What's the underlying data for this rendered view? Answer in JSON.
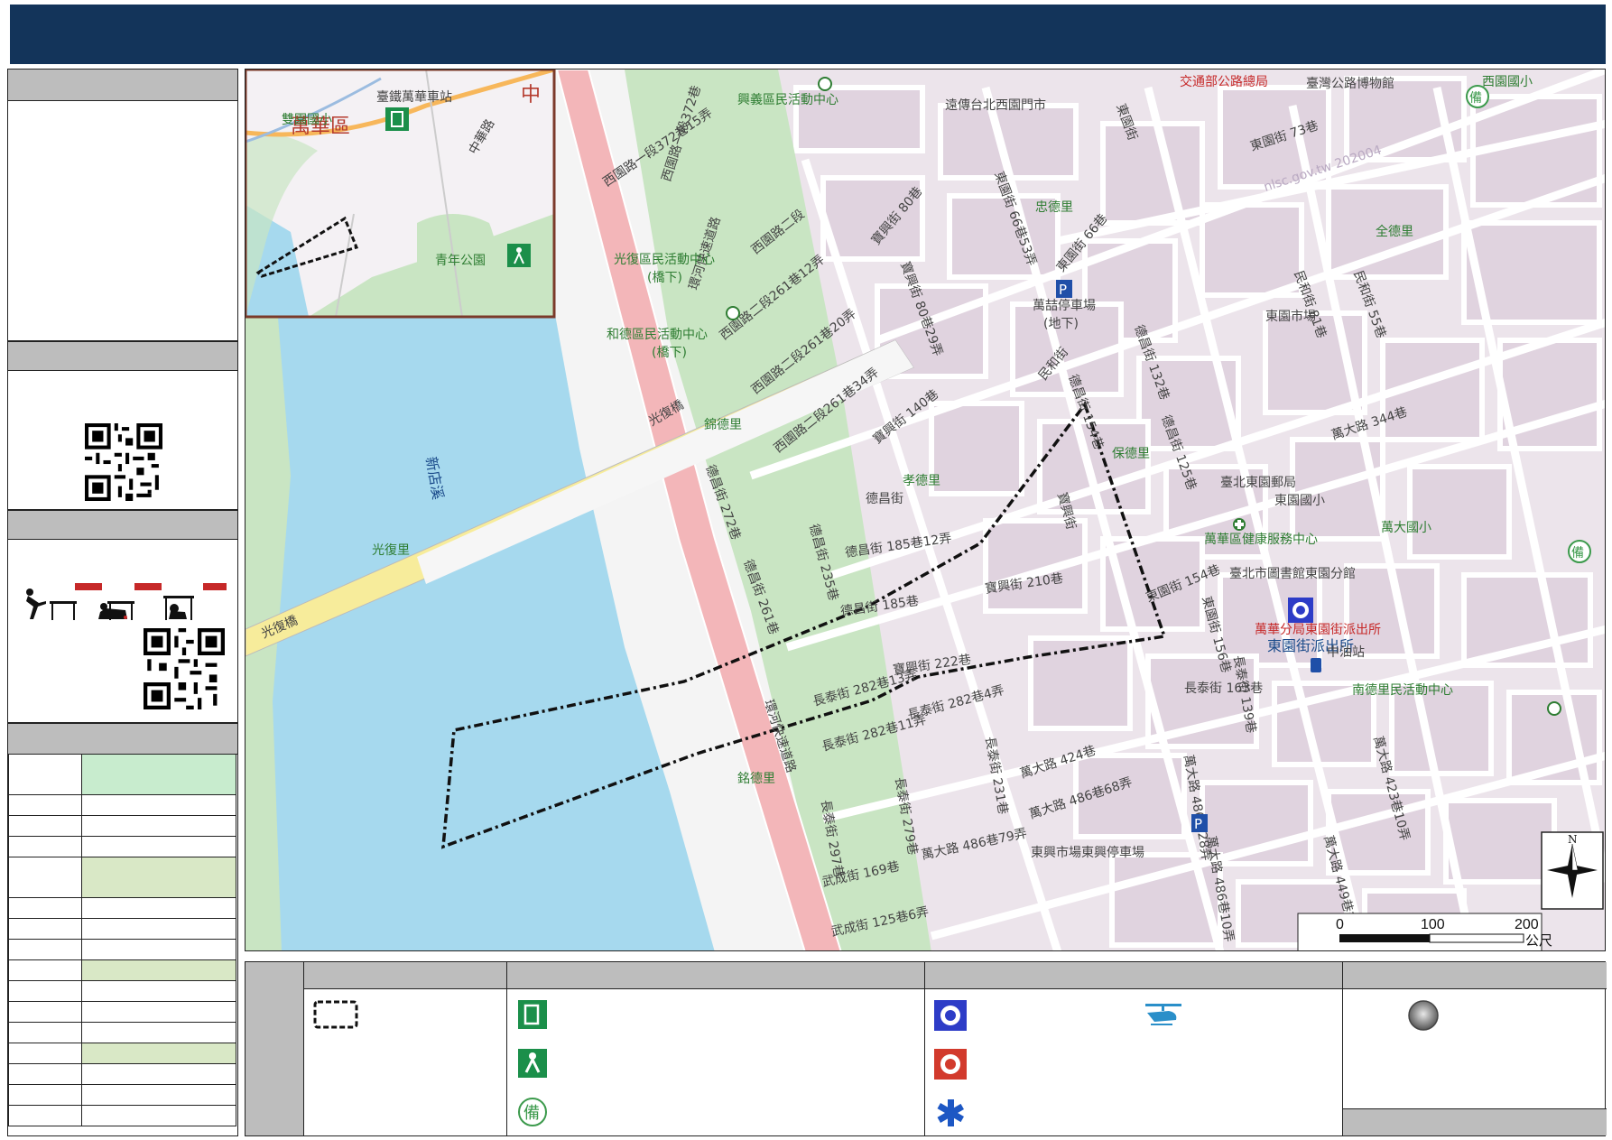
{
  "map": {
    "places": {
      "wanhua_district": "萬華區",
      "zhongzheng": "中",
      "wanhua_station": "臺鐵萬華車站",
      "shuangyuan_school": "雙園國小",
      "zhonghua_rd": "中華路",
      "youth_park": "青年公園",
      "xindian_creek": "新店溪",
      "guangfu_bridge_1": "光復橋",
      "guangfu_bridge_2": "光復橋",
      "guangfu_li": "光復里",
      "xingyi_center": "興義區民活動中心",
      "far_eastern": "遠傳台北西園門市",
      "moth_bureau": "交通部公路總局",
      "highway_museum": "臺灣公路博物館",
      "xiyuan_school": "西園國小",
      "huanhe_expressway_1": "環河快速道路",
      "huanhe_expressway_2": "環河快速道路",
      "xiyuan_rd_372_15": "西園路一段372巷15弄",
      "xiyuan_rd_372": "西園路一段372巷",
      "guangfu_center": "光復區民活動中心",
      "guangfu_center_sub": "(橋下)",
      "hede_center": "和德區民活動中心",
      "hede_center_sub": "(橋下)",
      "xiyuan_rd2": "西園路二段",
      "xiyuan_261_12": "西園路二段261巷12弄",
      "xiyuan_261_20": "西園路二段261巷20弄",
      "xiyuan_261_34": "西園路二段261巷34弄",
      "baoxing_80": "寶興街 80巷",
      "baoxing_80_29": "寶興街 80巷29弄",
      "baoxing_140": "寶興街 140巷",
      "dongyuan_66_53": "東園街 66巷53弄",
      "dongyuan_66": "東園街 66巷",
      "dongyuan_st": "東園街",
      "dongyuan_73": "東園街 73巷",
      "zhongde_li": "忠德里",
      "wanzhe_parking": "萬喆停車場",
      "wanzhe_parking_sub": "(地下)",
      "minhe_st": "民和街",
      "dechang_154": "德昌街 154巷",
      "dechang_132": "德昌街 132巷",
      "dechang_125": "德昌街 125巷",
      "dongyuan_market": "東園市場",
      "minhe_81": "民和街 81巷",
      "minhe_55": "民和街 55巷",
      "quande_li": "全德里",
      "jinde_li": "錦德里",
      "xiaode_li": "孝德里",
      "dechang_st": "德昌街",
      "dechang_272": "德昌街 272巷",
      "dechang_261": "德昌街 261巷",
      "dechang_235": "德昌街 235巷",
      "dechang_185_12": "德昌街 185巷12弄",
      "dechang_185": "德昌街 185巷",
      "baoxing_210": "寶興街 210巷",
      "baoxing_st": "寶興街",
      "baode_li": "保德里",
      "dongyuan_post": "臺北東園郵局",
      "dongyuan_school": "東園國小",
      "health_center": "萬華區健康服務中心",
      "library": "臺北市圖書館東園分館",
      "dechang_154b": "東園街 154巷",
      "dongyuan_156": "東園街 156巷",
      "wanda_344": "萬大路 344巷",
      "wanda_school": "萬大國小",
      "police_station": "萬華分局東園街派出所",
      "police_station_2": "東園街派出所",
      "gas_station": "中油站",
      "baoxing_222": "寶興街 222巷",
      "changtai_282_13": "長泰街 282巷13弄",
      "changtai_282_11": "長泰街 282巷11弄",
      "changtai_282_4": "長泰街 282巷4弄",
      "changtai_163": "長泰街 163巷",
      "changtai_139": "長泰街 139巷",
      "nande_center": "南德里民活動中心",
      "wanda_424": "萬大路 424巷",
      "wanda_486_68": "萬大路 486巷68弄",
      "wanda_486_79": "萬大路 486巷79弄",
      "wanda_486_28": "萬大路 486巷28弄",
      "wanda_486_10": "萬大路 486巷10弄",
      "wanda_423_10": "萬大路 423巷10弄",
      "wanda_449_10": "萬大路 449巷10弄",
      "changtai_231": "長泰街 231巷",
      "changtai_279": "長泰街 279巷",
      "changtai_297": "長泰街 297巷",
      "mingde_li": "銘德里",
      "wucheng_169": "武成街 169巷",
      "wucheng_125_6": "武成街 125巷6弄",
      "dongxing_parking": "東興市場東興停車場",
      "watermark": "nlsc.gov.tw 202004"
    },
    "north_label": "N",
    "scale": {
      "t0": "0",
      "t1": "100",
      "t2": "200",
      "unit": "公尺"
    },
    "colors": {
      "river": "#a6d9ee",
      "green": "#c9e5c3",
      "urban": "#ece4eb",
      "block": "#e0d3df",
      "expressway": "#f3b6b9",
      "boundary": "#111111"
    }
  },
  "icons": [
    "evacuation-shelter-icon",
    "park-refuge-icon",
    "reserve-shelter-icon",
    "police-station-icon",
    "fire-station-icon",
    "medical-icon",
    "helicopter-icon",
    "gas-station-icon",
    "community-center-icon"
  ]
}
